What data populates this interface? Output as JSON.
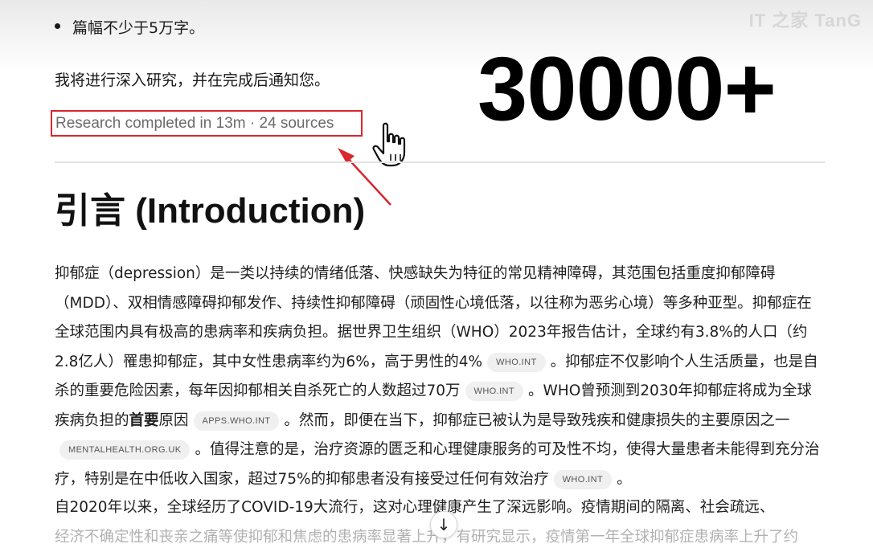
{
  "watermark": "IT 之家 TanG",
  "bullet": "篇幅不少于5万字。",
  "notify_text": "我将进行深入研究，并在完成后通知您。",
  "overlay_number": "30000+",
  "research_status": "Research completed in 13m · 24 sources",
  "section_title": "引言 (Introduction)",
  "paragraph1": {
    "s1": "抑郁症（depression）是一类以持续的情绪低落、快感缺失为特征的常见精神障碍，其范围包括重度抑郁障碍（MDD）、双相情感障碍抑郁发作、持续性抑郁障碍（顽固性心境低落，以往称为恶劣心境）等多种亚型。抑郁症在全球范围内具有极高的患病率和疾病负担。据世界卫生组织（WHO）2023年报告估计，全球约有3.8%的人口（约2.8亿人）罹患抑郁症，其中女性患病率约为6%，高于男性的4%",
    "c1": "WHO.INT",
    "s2": "。抑郁症不仅影响个人生活质量，也是自杀的重要危险因素，每年因抑郁相关自杀死亡的人数超过70万",
    "c2": "WHO.INT",
    "s3": "。WHO曾预测到2030年抑郁症将成为全球疾病负担的",
    "s3_bold": "首要",
    "s3b": "原因",
    "c3": "APPS.WHO.INT",
    "s4": "。然而，即便在当下，抑郁症已被认为是导致残疾和健康损失的主要原因之一",
    "c4": "MENTALHEALTH.ORG.UK",
    "s5": "。值得注意的是，治疗资源的匮乏和心理健康服务的可及性不均，使得大量患者未能得到充分治疗，特别是在中低收入国家，超过75%的抑郁患者没有接受过任何有效治疗",
    "c5": "WHO.INT",
    "s6": "。"
  },
  "paragraph2": {
    "line1": "自2020年以来，全球经历了COVID-19大流行，这对心理健康产生了深远影响。疫情期间的隔离、社会疏远、",
    "line2": "经济不确定性和丧亲之痛等使抑郁和焦虑的患病率显著上升，有研究显示，疫情第一年全球抑郁症患病率上升了约"
  },
  "icons": {
    "cursor": "hand-pointer-icon",
    "arrow": "red-annotation-arrow-icon",
    "scroll": "arrow-down-icon"
  },
  "colors": {
    "highlight_border": "#d9262e",
    "chip_bg": "#f0f0f0"
  }
}
